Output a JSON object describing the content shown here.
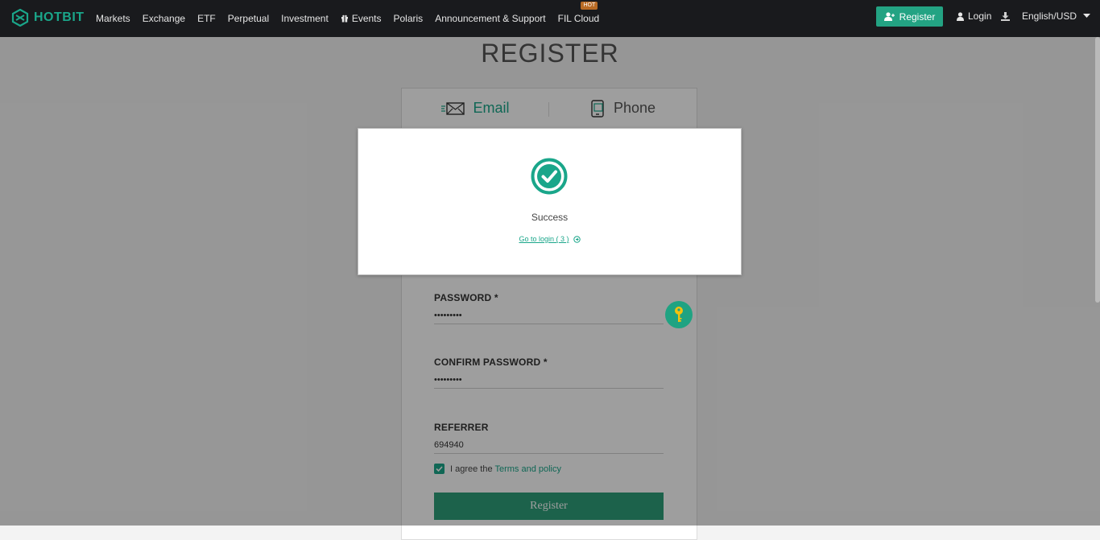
{
  "brand": {
    "name": "HOTBIT",
    "accent": "#1aa68a"
  },
  "nav": {
    "items": [
      {
        "label": "Markets"
      },
      {
        "label": "Exchange"
      },
      {
        "label": "ETF"
      },
      {
        "label": "Perpetual"
      },
      {
        "label": "Investment"
      },
      {
        "label": "Events",
        "icon": "gift-icon"
      },
      {
        "label": "Polaris"
      },
      {
        "label": "Announcement & Support"
      },
      {
        "label": "FIL Cloud",
        "badge": "HOT"
      }
    ],
    "register_label": "Register",
    "login_label": "Login",
    "language_label": "English/USD"
  },
  "page": {
    "title": "REGISTER",
    "tabs": {
      "email": "Email",
      "phone": "Phone"
    },
    "password": {
      "label": "PASSWORD *",
      "value": "•••••••••"
    },
    "confirm_password": {
      "label": "CONFIRM PASSWORD *",
      "value": "•••••••••"
    },
    "referrer": {
      "label": "REFERRER",
      "value": "694940"
    },
    "agree": {
      "text": "I agree the",
      "link": "Terms and policy",
      "checked": true
    },
    "submit_label": "Register"
  },
  "modal": {
    "status": "Success",
    "goto_label": "Go to login ( 3 )"
  }
}
